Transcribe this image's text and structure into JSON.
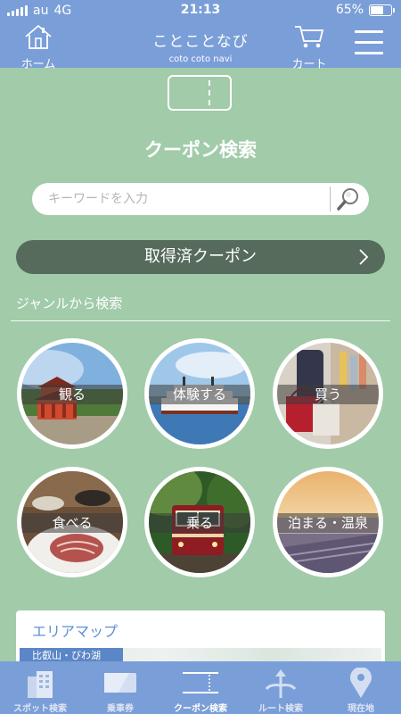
{
  "status_bar": {
    "carrier": "au",
    "network": "4G",
    "time": "21:13",
    "battery_percent": "65%",
    "battery_level": 0.65
  },
  "header": {
    "home_label": "ホーム",
    "title": "ことことなび",
    "subtitle": "coto coto navi",
    "cart_label": "カート"
  },
  "page": {
    "title": "クーポン検索"
  },
  "search": {
    "placeholder": "キーワードを入力",
    "value": ""
  },
  "acquired_coupons": {
    "label": "取得済クーポン"
  },
  "genre": {
    "heading": "ジャンルから検索",
    "items": [
      {
        "label": "観る"
      },
      {
        "label": "体験する"
      },
      {
        "label": "買う"
      },
      {
        "label": "食べる"
      },
      {
        "label": "乗る"
      },
      {
        "label": "泊まる・温泉"
      }
    ]
  },
  "area_map": {
    "title": "エリアマップ",
    "region_label": "比叡山・びわ湖"
  },
  "tabs": [
    {
      "label": "スポット検索",
      "icon": "building-icon",
      "active": false
    },
    {
      "label": "乗車券",
      "icon": "ticket-icon",
      "active": false
    },
    {
      "label": "クーポン検索",
      "icon": "coupon-icon",
      "active": true
    },
    {
      "label": "ルート検索",
      "icon": "route-icon",
      "active": false
    },
    {
      "label": "現在地",
      "icon": "location-pin-icon",
      "active": false
    }
  ],
  "colors": {
    "header": "#7a9ed8",
    "background": "#a1cba9",
    "coupon_button": "#566b5c",
    "accent_text": "#5c8fd6"
  }
}
